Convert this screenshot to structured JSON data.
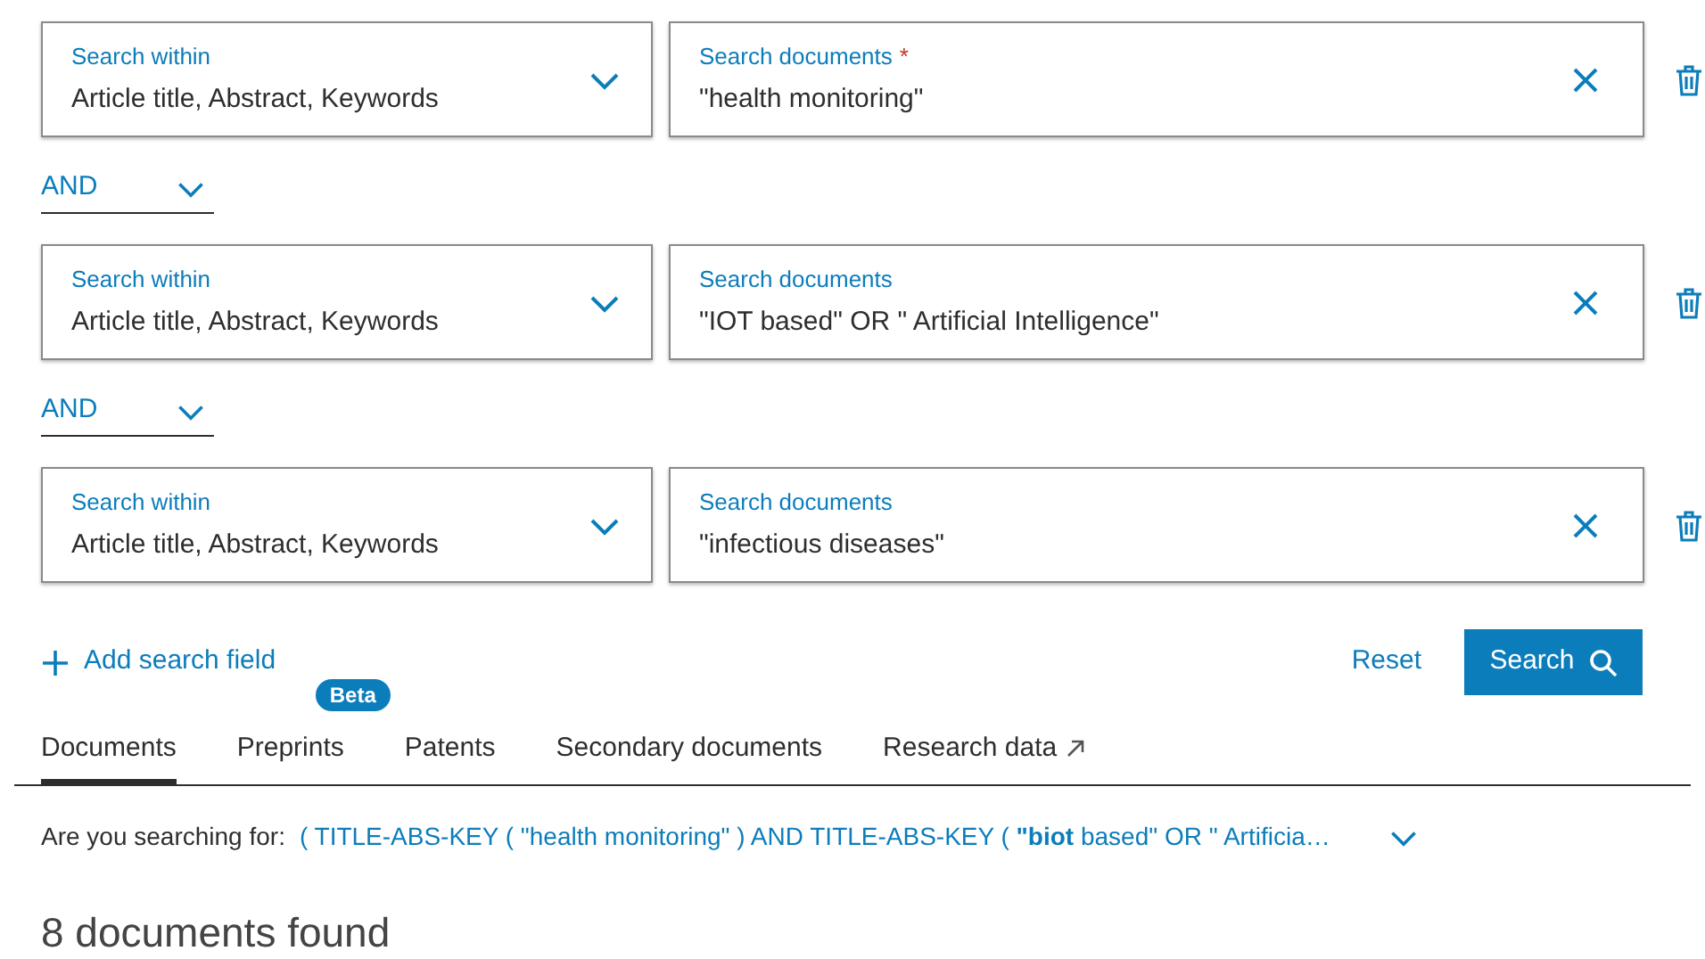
{
  "search_rows": [
    {
      "within_label": "Search within",
      "within_value": "Article title, Abstract, Keywords",
      "query_label": "Search documents",
      "required": true,
      "query_value": "\"health monitoring\""
    },
    {
      "connector": "AND",
      "within_label": "Search within",
      "within_value": "Article title, Abstract, Keywords",
      "query_label": "Search documents",
      "required": false,
      "query_value": "\"IOT based\" OR \" Artificial Intelligence\""
    },
    {
      "connector": "AND",
      "within_label": "Search within",
      "within_value": "Article title, Abstract, Keywords",
      "query_label": "Search documents",
      "required": false,
      "query_value": "\"infectious diseases\""
    }
  ],
  "required_mark": "*",
  "add_field": "Add search field",
  "reset": "Reset",
  "search": "Search",
  "tabs": [
    {
      "label": "Documents",
      "selected": true
    },
    {
      "label": "Preprints",
      "selected": false,
      "badge": "Beta"
    },
    {
      "label": "Patents",
      "selected": false
    },
    {
      "label": "Secondary documents",
      "selected": false
    },
    {
      "label": "Research data",
      "selected": false,
      "external": true
    }
  ],
  "suggestion": {
    "label": "Are you searching for:",
    "query": "( TITLE-ABS-KEY ( \"health monitoring\" ) AND TITLE-ABS-KEY ( **\"biot** based\" OR \" Artificia…"
  },
  "results": "8 documents found"
}
